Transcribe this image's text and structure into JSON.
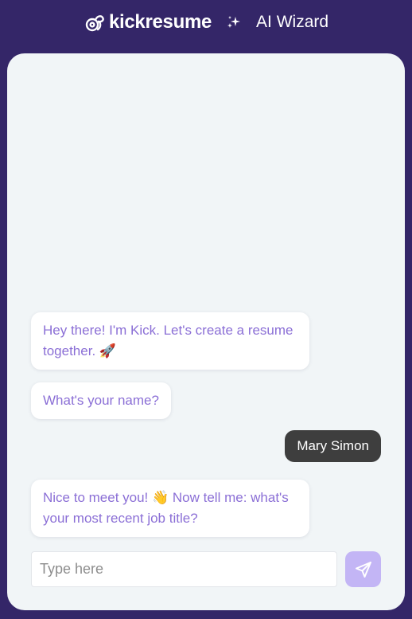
{
  "header": {
    "brand_name": "kickresume",
    "title": "AI Wizard",
    "logo_icon": "kickresume-logo-icon",
    "sparkle_icon": "sparkle-icon"
  },
  "chat": {
    "messages": [
      {
        "sender": "bot",
        "text": "Hey there! I'm Kick. Let's create a resume together. 🚀"
      },
      {
        "sender": "bot",
        "text": "What's your name?"
      },
      {
        "sender": "user",
        "text": "Mary Simon"
      },
      {
        "sender": "bot",
        "text": "Nice to meet you! 👋 Now tell me: what's your most recent job title?"
      }
    ]
  },
  "composer": {
    "placeholder": "Type here",
    "value": "",
    "send_icon": "send-icon"
  },
  "colors": {
    "background": "#342668",
    "panel": "#f1f5f7",
    "bot_text": "#8b6fd6",
    "user_bubble": "#3e3e3e",
    "send_button": "#c3b5f5"
  }
}
